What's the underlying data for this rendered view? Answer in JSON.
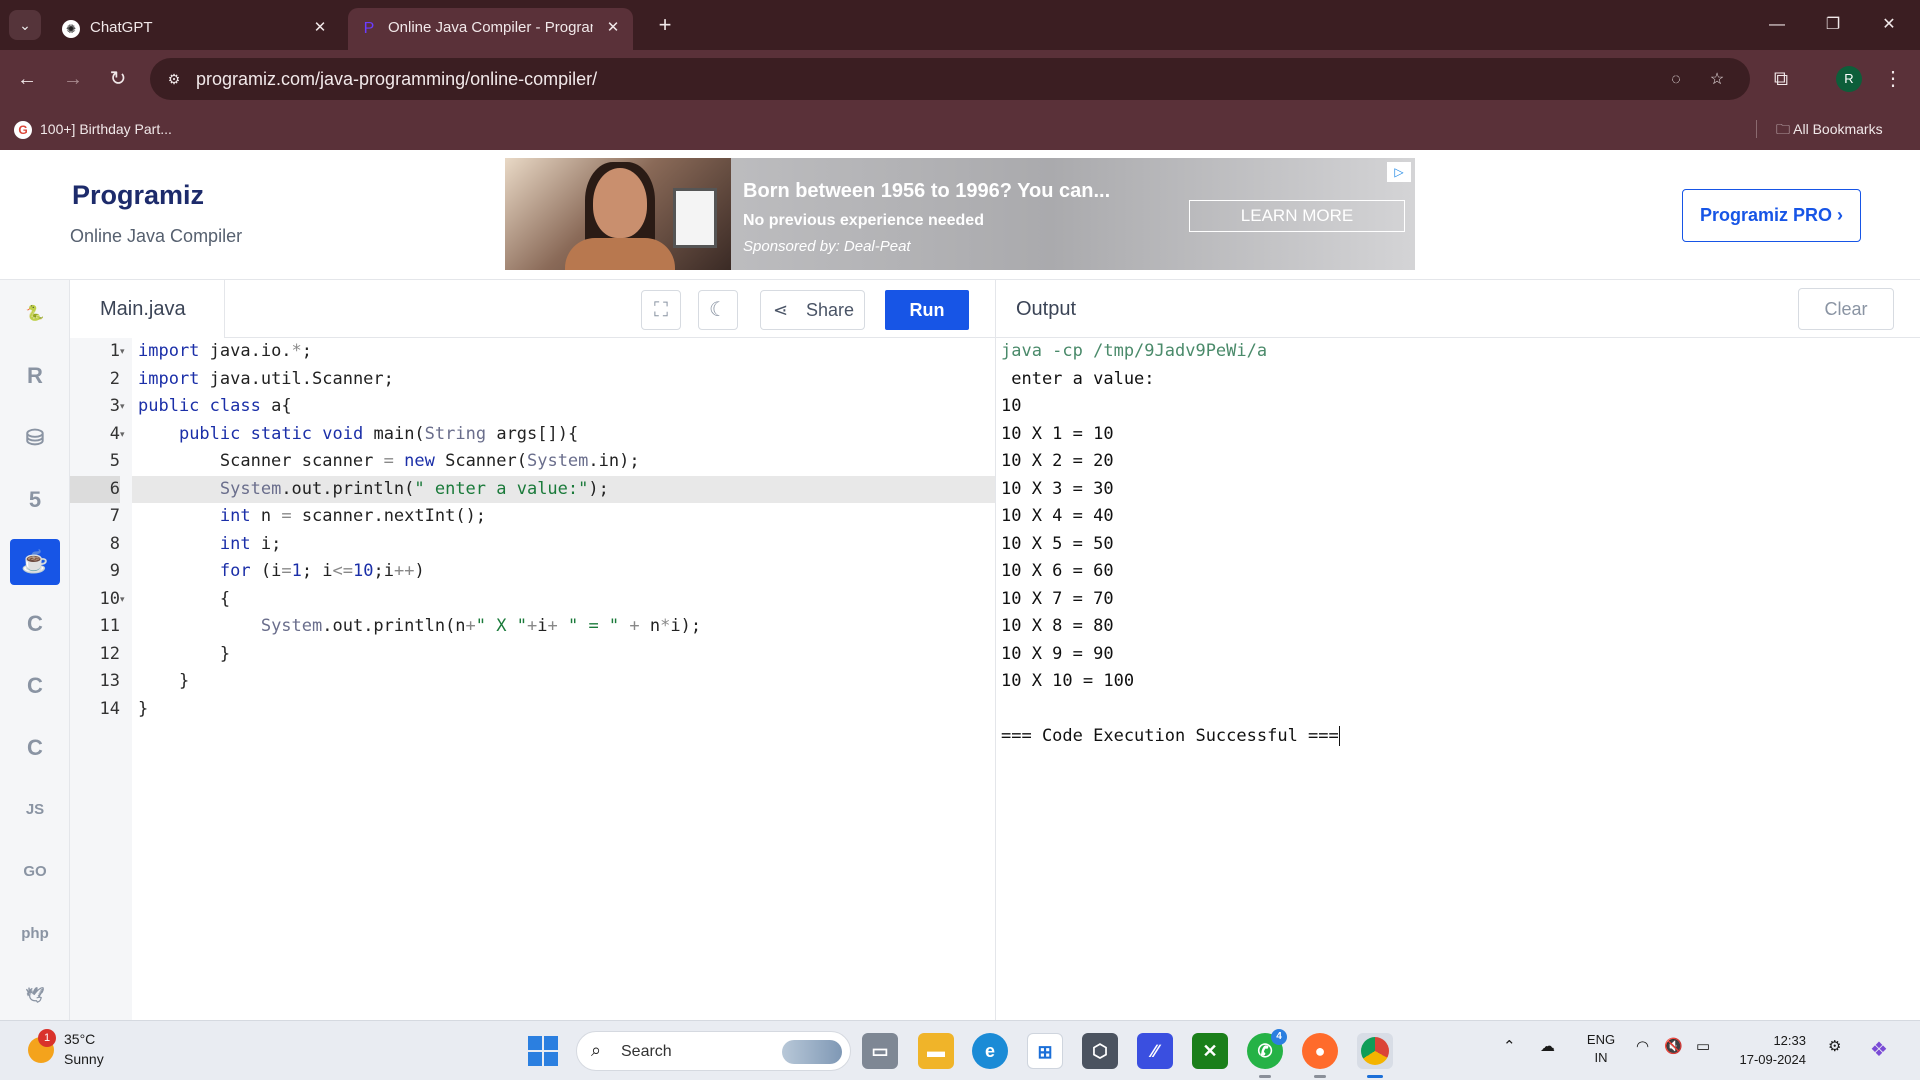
{
  "browser": {
    "tabs": [
      {
        "title": "ChatGPT",
        "active": false
      },
      {
        "title": "Online Java Compiler - Program",
        "active": true
      }
    ],
    "url": "programiz.com/java-programming/online-compiler/",
    "bookmarks": [
      {
        "label": "100+] Birthday Part..."
      }
    ],
    "all_bookmarks": "All Bookmarks",
    "profile_initial": "R"
  },
  "site": {
    "logo": "Programiz",
    "subtitle": "Online Java Compiler",
    "pro_button": "Programiz PRO ›",
    "ad": {
      "title": "Born between 1956 to 1996? You can...",
      "subtitle": "No previous experience needed",
      "sponsor": "Sponsored by: Deal-Peat",
      "cta": "LEARN MORE"
    }
  },
  "rail": {
    "languages": [
      {
        "name": "Python",
        "glyph": "🐍"
      },
      {
        "name": "R",
        "glyph": "R"
      },
      {
        "name": "SQL",
        "glyph": "⛁"
      },
      {
        "name": "HTML",
        "glyph": "5"
      },
      {
        "name": "Java",
        "glyph": "☕",
        "active": true
      },
      {
        "name": "C",
        "glyph": "C"
      },
      {
        "name": "C++",
        "glyph": "C"
      },
      {
        "name": "C#",
        "glyph": "C"
      },
      {
        "name": "JavaScript",
        "glyph": "JS"
      },
      {
        "name": "Go",
        "glyph": "GO"
      },
      {
        "name": "PHP",
        "glyph": "php"
      },
      {
        "name": "Swift",
        "glyph": "🕊"
      }
    ]
  },
  "editor": {
    "file_name": "Main.java",
    "share_label": "Share",
    "run_label": "Run",
    "highlighted_line": 6,
    "lines": [
      "import java.io.*;",
      "import java.util.Scanner;",
      "public class a{",
      "    public static void main(String args[]){",
      "        Scanner scanner = new Scanner(System.in);",
      "        System.out.println(\" enter a value:\");",
      "        int n = scanner.nextInt();",
      "        int i;",
      "        for (i=1; i<=10;i++)",
      "        {",
      "            System.out.println(n+\" X \"+i+ \" = \" + n*i);",
      "        }",
      "    }",
      "}"
    ],
    "foldable_lines": [
      1,
      3,
      4,
      10
    ]
  },
  "output": {
    "title": "Output",
    "clear_label": "Clear",
    "command": "java -cp /tmp/9Jadv9PeWi/a",
    "lines": [
      " enter a value:",
      "10",
      "10 X 1 = 10",
      "10 X 2 = 20",
      "10 X 3 = 30",
      "10 X 4 = 40",
      "10 X 5 = 50",
      "10 X 6 = 60",
      "10 X 7 = 70",
      "10 X 8 = 80",
      "10 X 9 = 90",
      "10 X 10 = 100",
      "",
      "=== Code Execution Successful ==="
    ]
  },
  "taskbar": {
    "weather_temp": "35°C",
    "weather_desc": "Sunny",
    "weather_badge": "1",
    "search_label": "Search",
    "whatsapp_badge": "4",
    "lang_line1": "ENG",
    "lang_line2": "IN",
    "time": "12:33",
    "date": "17-09-2024"
  },
  "colors": {
    "accent": "#1755e6",
    "browser_frame": "#3b1e22",
    "browser_toolbar": "#5a3139",
    "keyword": "#1b2fa8",
    "string": "#1a7a3a"
  }
}
